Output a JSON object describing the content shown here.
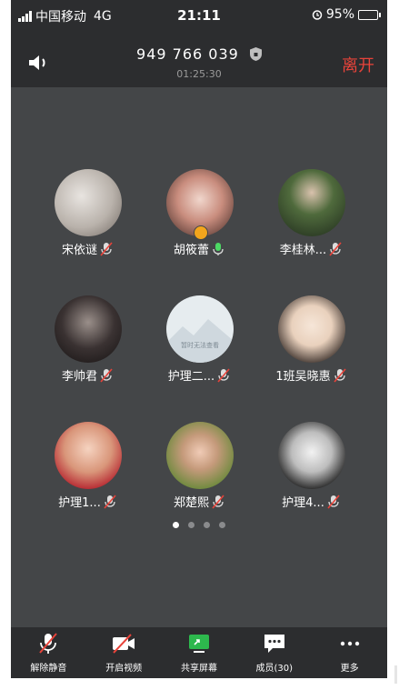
{
  "status_bar": {
    "carrier": "中国移动",
    "network": "4G",
    "time": "21:11",
    "battery": "95%"
  },
  "header": {
    "meeting_id": "949 766 039",
    "duration": "01:25:30",
    "leave_label": "离开"
  },
  "participants": [
    {
      "name": "宋依谜",
      "mic": "muted",
      "avatar": "photo"
    },
    {
      "name": "胡筱蕾",
      "mic": "on",
      "avatar": "photo",
      "host": true
    },
    {
      "name": "李桂林...",
      "mic": "muted",
      "avatar": "photo"
    },
    {
      "name": "李帅君",
      "mic": "muted",
      "avatar": "photo"
    },
    {
      "name": "护理二...",
      "mic": "muted",
      "avatar": "placeholder",
      "avatar_text": "暂时无法查看"
    },
    {
      "name": "1班吴晓惠",
      "mic": "muted",
      "avatar": "photo"
    },
    {
      "name": "护理1...",
      "mic": "muted",
      "avatar": "photo"
    },
    {
      "name": "郑楚熙",
      "mic": "muted",
      "avatar": "photo"
    },
    {
      "name": "护理4...",
      "mic": "muted",
      "avatar": "photo"
    }
  ],
  "pager": {
    "pages": 4,
    "current": 1
  },
  "toolbar": {
    "unmute": "解除静音",
    "start_video": "开启视频",
    "share_screen": "共享屏幕",
    "members": "成员(30)",
    "more": "更多"
  },
  "colors": {
    "leave": "#e8433a",
    "mic_on": "#4cd964",
    "mic_muted": "#e8433a",
    "share": "#2db84d",
    "host_badge": "#f3a51c"
  }
}
